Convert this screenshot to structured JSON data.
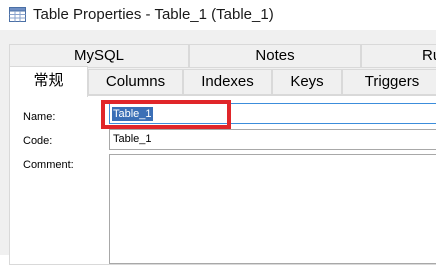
{
  "window": {
    "title": "Table Properties - Table_1 (Table_1)",
    "icon": "table-icon"
  },
  "tabs_row1": [
    "MySQL",
    "Notes",
    "Ru"
  ],
  "tabs_row2": [
    "常规",
    "Columns",
    "Indexes",
    "Keys",
    "Triggers"
  ],
  "active_tab": "常规",
  "form": {
    "name_label": "Name:",
    "name_value": "Table_1",
    "code_label": "Code:",
    "code_value": "Table_1",
    "comment_label": "Comment:",
    "comment_value": ""
  },
  "colors": {
    "highlight": "#e0262a",
    "selection": "#3b6fb6",
    "focus_border": "#3c8ddb"
  }
}
